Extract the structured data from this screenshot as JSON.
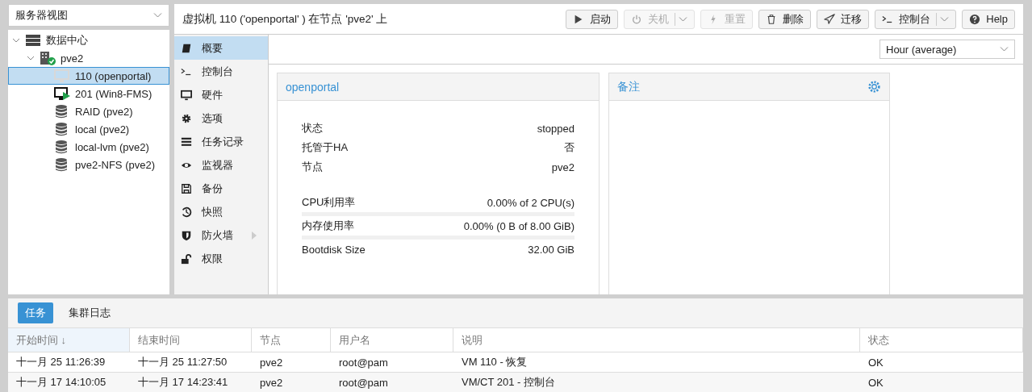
{
  "view_select": {
    "value": "服务器视图"
  },
  "tree": [
    {
      "label": "数据中心",
      "kind": "datacenter",
      "expanded": true,
      "selected": false,
      "children": [
        {
          "label": "pve2",
          "kind": "node",
          "expanded": true,
          "selected": false,
          "children": [
            {
              "label": "110 (openportal)",
              "kind": "vm-stopped",
              "selected": true
            },
            {
              "label": "201 (Win8-FMS)",
              "kind": "vm-running",
              "selected": false
            },
            {
              "label": "RAID (pve2)",
              "kind": "storage",
              "selected": false
            },
            {
              "label": "local (pve2)",
              "kind": "storage",
              "selected": false
            },
            {
              "label": "local-lvm (pve2)",
              "kind": "storage",
              "selected": false
            },
            {
              "label": "pve2-NFS (pve2)",
              "kind": "storage",
              "selected": false
            }
          ]
        }
      ]
    }
  ],
  "header": {
    "title": "虚拟机 110 ('openportal' ) 在节点 'pve2' 上",
    "buttons": [
      {
        "label": "启动",
        "kind": "play",
        "disabled": false,
        "dropdown": false
      },
      {
        "label": "关机",
        "kind": "power",
        "disabled": true,
        "dropdown": true
      },
      {
        "label": "重置",
        "kind": "bolt",
        "disabled": true,
        "dropdown": false
      },
      {
        "label": "删除",
        "kind": "trash",
        "disabled": false,
        "dropdown": false
      },
      {
        "label": "迁移",
        "kind": "plane",
        "disabled": false,
        "dropdown": false
      },
      {
        "label": "控制台",
        "kind": "terminal",
        "disabled": false,
        "dropdown": true
      },
      {
        "label": "Help",
        "kind": "help",
        "disabled": false,
        "dropdown": false
      }
    ]
  },
  "nav": [
    {
      "label": "概要",
      "kind": "book",
      "selected": true,
      "submenu": false
    },
    {
      "label": "控制台",
      "kind": "terminal",
      "selected": false,
      "submenu": false
    },
    {
      "label": "硬件",
      "kind": "monitor",
      "selected": false,
      "submenu": false
    },
    {
      "label": "选项",
      "kind": "gear",
      "selected": false,
      "submenu": false
    },
    {
      "label": "任务记录",
      "kind": "list",
      "selected": false,
      "submenu": false
    },
    {
      "label": "监视器",
      "kind": "eye",
      "selected": false,
      "submenu": false
    },
    {
      "label": "备份",
      "kind": "save",
      "selected": false,
      "submenu": false
    },
    {
      "label": "快照",
      "kind": "history",
      "selected": false,
      "submenu": false
    },
    {
      "label": "防火墙",
      "kind": "shield",
      "selected": false,
      "submenu": true
    },
    {
      "label": "权限",
      "kind": "unlock",
      "selected": false,
      "submenu": false
    }
  ],
  "timeframe": {
    "value": "Hour (average)"
  },
  "status_panel": {
    "title": "openportal",
    "rows": [
      {
        "label": "状态",
        "value": "stopped",
        "kind": "text"
      },
      {
        "label": "托管于HA",
        "value": "否",
        "kind": "text"
      },
      {
        "label": "节点",
        "value": "pve2",
        "kind": "text"
      },
      {
        "kind": "spacer"
      },
      {
        "label": "CPU利用率",
        "value": "0.00% of 2 CPU(s)",
        "kind": "bar",
        "level": 0
      },
      {
        "label": "内存使用率",
        "value": "0.00% (0 B of 8.00 GiB)",
        "kind": "bar",
        "level": 0
      },
      {
        "label": "Bootdisk Size",
        "value": "32.00 GiB",
        "kind": "text"
      }
    ]
  },
  "notes_panel": {
    "title": "备注"
  },
  "bottom_tabs": [
    {
      "label": "任务",
      "selected": true
    },
    {
      "label": "集群日志",
      "selected": false
    }
  ],
  "tasks": {
    "columns": [
      {
        "label": "开始时间 ↓",
        "sorted": true
      },
      {
        "label": "结束时间",
        "sorted": false
      },
      {
        "label": "节点",
        "sorted": false
      },
      {
        "label": "用户名",
        "sorted": false
      },
      {
        "label": "说明",
        "sorted": false
      },
      {
        "label": "状态",
        "sorted": false
      }
    ],
    "rows": [
      [
        "十一月 25 11:26:39",
        "十一月 25 11:27:50",
        "pve2",
        "root@pam",
        "VM 110 - 恢复",
        "OK"
      ],
      [
        "十一月 17 14:10:05",
        "十一月 17 14:23:41",
        "pve2",
        "root@pam",
        "VM/CT 201 - 控制台",
        "OK"
      ]
    ]
  }
}
